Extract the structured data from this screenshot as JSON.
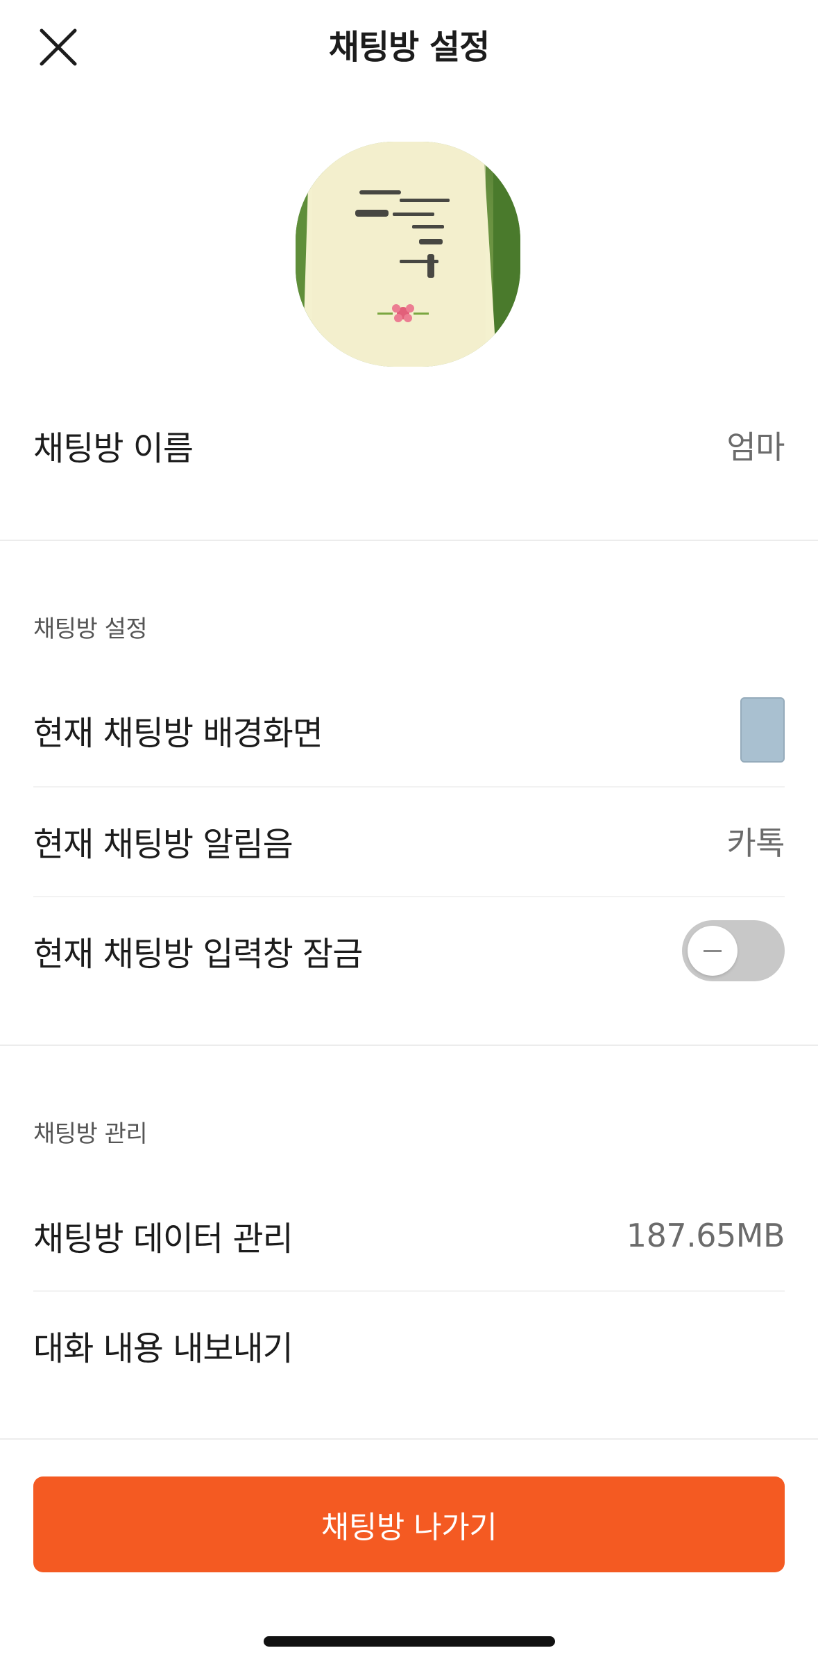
{
  "header": {
    "title": "채팅방 설정",
    "close_icon": "close-icon"
  },
  "room": {
    "name_label": "채팅방 이름",
    "name_value": "엄마"
  },
  "settings_section": {
    "header": "채팅방 설정",
    "wallpaper_label": "현재 채팅방 배경화면",
    "wallpaper_color": "#a9c0d0",
    "sound_label": "현재 채팅방 알림음",
    "sound_value": "카톡",
    "lock_label": "현재 채팅방 입력창 잠금",
    "lock_enabled": false
  },
  "manage_section": {
    "header": "채팅방 관리",
    "data_label": "채팅방 데이터 관리",
    "data_value": "187.65MB",
    "export_label": "대화 내용 내보내기"
  },
  "leave_button": {
    "label": "채팅방 나가기",
    "color": "#f45a22"
  }
}
